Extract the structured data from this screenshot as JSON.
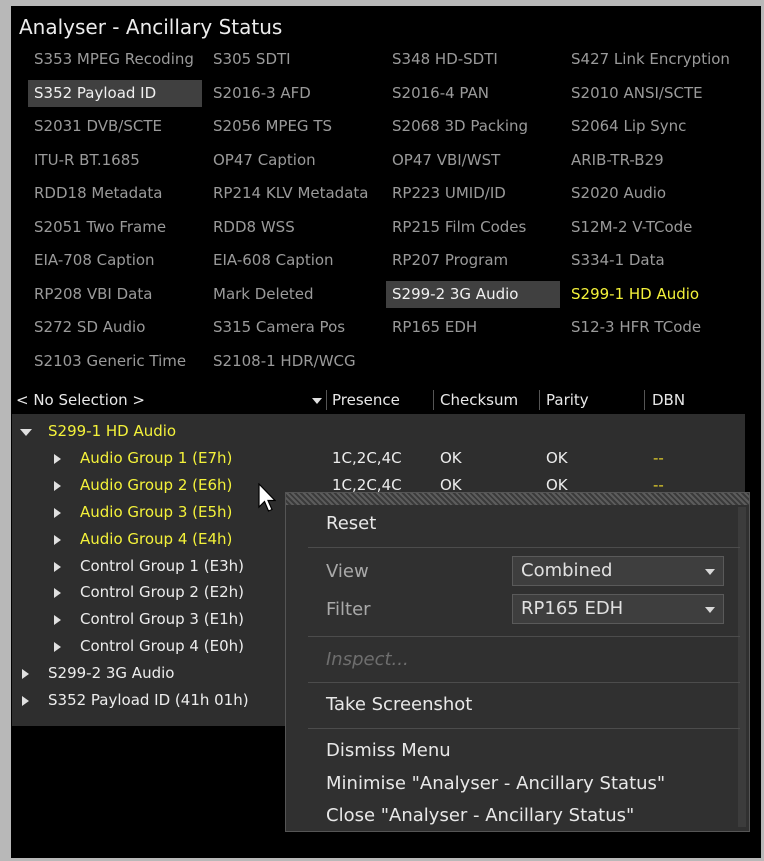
{
  "window": {
    "title": "Analyser - Ancillary Status"
  },
  "grid": [
    [
      {
        "label": "S353 MPEG Recoding"
      },
      {
        "label": "S305 SDTI"
      },
      {
        "label": "S348 HD-SDTI"
      },
      {
        "label": "S427 Link Encryption"
      }
    ],
    [
      {
        "label": "S352 Payload ID",
        "state": "selected"
      },
      {
        "label": "S2016-3 AFD"
      },
      {
        "label": "S2016-4 PAN"
      },
      {
        "label": "S2010 ANSI/SCTE"
      }
    ],
    [
      {
        "label": "S2031 DVB/SCTE"
      },
      {
        "label": "S2056 MPEG TS"
      },
      {
        "label": "S2068 3D Packing"
      },
      {
        "label": "S2064 Lip Sync"
      }
    ],
    [
      {
        "label": "ITU-R BT.1685"
      },
      {
        "label": "OP47 Caption"
      },
      {
        "label": "OP47 VBI/WST"
      },
      {
        "label": "ARIB-TR-B29"
      }
    ],
    [
      {
        "label": "RDD18 Metadata"
      },
      {
        "label": "RP214 KLV Metadata"
      },
      {
        "label": "RP223 UMID/ID"
      },
      {
        "label": "S2020 Audio"
      }
    ],
    [
      {
        "label": "S2051 Two Frame"
      },
      {
        "label": "RDD8 WSS"
      },
      {
        "label": "RP215 Film Codes"
      },
      {
        "label": "S12M-2 V-TCode"
      }
    ],
    [
      {
        "label": "EIA-708 Caption"
      },
      {
        "label": "EIA-608 Caption"
      },
      {
        "label": "RP207 Program"
      },
      {
        "label": "S334-1 Data"
      }
    ],
    [
      {
        "label": "RP208 VBI Data"
      },
      {
        "label": "Mark Deleted"
      },
      {
        "label": "S299-2 3G Audio",
        "state": "selected"
      },
      {
        "label": "S299-1 HD Audio",
        "state": "highlight"
      }
    ],
    [
      {
        "label": "S272 SD Audio"
      },
      {
        "label": "S315 Camera Pos"
      },
      {
        "label": "RP165 EDH"
      },
      {
        "label": "S12-3 HFR TCode"
      }
    ],
    [
      {
        "label": "S2103 Generic Time"
      },
      {
        "label": "S2108-1 HDR/WCG"
      }
    ]
  ],
  "table": {
    "selector": "< No Selection >",
    "columns": {
      "presence": "Presence",
      "checksum": "Checksum",
      "parity": "Parity",
      "dbn": "DBN"
    },
    "rows": [
      {
        "label": "S299-1 HD Audio",
        "level": 0,
        "expanded": true,
        "yellow": true,
        "presence": "",
        "checksum": "",
        "parity": "",
        "dbn": ""
      },
      {
        "label": "Audio Group 1 (E7h)",
        "level": 1,
        "expanded": false,
        "yellow": true,
        "presence": "1C,2C,4C",
        "checksum": "OK",
        "parity": "OK",
        "dbn": "--"
      },
      {
        "label": "Audio Group 2 (E6h)",
        "level": 1,
        "expanded": false,
        "yellow": true,
        "presence": "1C,2C,4C",
        "checksum": "OK",
        "parity": "OK",
        "dbn": "--"
      },
      {
        "label": "Audio Group 3 (E5h)",
        "level": 1,
        "expanded": false,
        "yellow": true,
        "presence": "",
        "checksum": "",
        "parity": "",
        "dbn": ""
      },
      {
        "label": "Audio Group 4 (E4h)",
        "level": 1,
        "expanded": false,
        "yellow": true,
        "presence": "",
        "checksum": "",
        "parity": "",
        "dbn": ""
      },
      {
        "label": "Control Group 1 (E3h)",
        "level": 1,
        "expanded": false,
        "yellow": false,
        "presence": "",
        "checksum": "",
        "parity": "",
        "dbn": ""
      },
      {
        "label": "Control Group 2 (E2h)",
        "level": 1,
        "expanded": false,
        "yellow": false,
        "presence": "",
        "checksum": "",
        "parity": "",
        "dbn": ""
      },
      {
        "label": "Control Group 3 (E1h)",
        "level": 1,
        "expanded": false,
        "yellow": false,
        "presence": "",
        "checksum": "",
        "parity": "",
        "dbn": ""
      },
      {
        "label": "Control Group 4 (E0h)",
        "level": 1,
        "expanded": false,
        "yellow": false,
        "presence": "",
        "checksum": "",
        "parity": "",
        "dbn": ""
      },
      {
        "label": "S299-2 3G Audio",
        "level": 0,
        "expanded": false,
        "yellow": false,
        "presence": "",
        "checksum": "",
        "parity": "",
        "dbn": ""
      },
      {
        "label": "S352 Payload ID (41h 01h)",
        "level": 0,
        "expanded": false,
        "yellow": false,
        "presence": "",
        "checksum": "",
        "parity": "",
        "dbn": ""
      }
    ]
  },
  "menu": {
    "reset": "Reset",
    "view_label": "View",
    "view_value": "Combined",
    "filter_label": "Filter",
    "filter_value": "RP165 EDH",
    "inspect": "Inspect...",
    "screenshot": "Take Screenshot",
    "dismiss": "Dismiss Menu",
    "minimise": "Minimise \"Analyser - Ancillary Status\"",
    "close": "Close \"Analyser - Ancillary Status\""
  },
  "colors": {
    "highlight_text": "#f4f23a",
    "selected_bg": "#404040",
    "tree_bg": "#2e2e2e",
    "dbn_dash": "#e7d22a"
  }
}
